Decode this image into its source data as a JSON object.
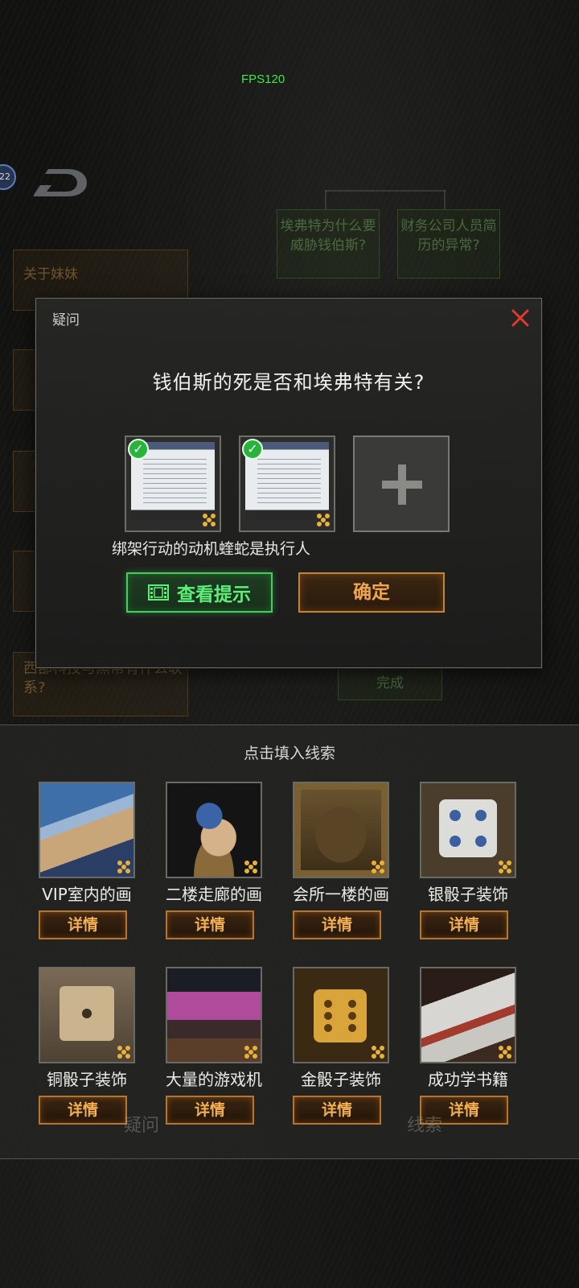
{
  "hud": {
    "fps": "FPS120",
    "badge": "22"
  },
  "background_nodes": {
    "node1": "埃弗特为什么要威胁钱伯斯?",
    "node2": "财务公司人员简历的异常?",
    "node3": "关于妹妹",
    "node4": "西部科技与黑帮有什么联系?",
    "node5": "完成",
    "tab_left": "疑问",
    "tab_right": "线索"
  },
  "dialog": {
    "title": "疑问",
    "question": "钱伯斯的死是否和埃弗特有关?",
    "slot_labels": "绑架行动的动机蝰蛇是执行人",
    "hint_button": "查看提示",
    "confirm_button": "确定"
  },
  "clue_panel": {
    "title": "点击填入线索",
    "detail_label": "详情",
    "items": [
      {
        "label": "VIP室内的画"
      },
      {
        "label": "二楼走廊的画"
      },
      {
        "label": "会所一楼的画"
      },
      {
        "label": "银骰子装饰"
      },
      {
        "label": "铜骰子装饰"
      },
      {
        "label": "大量的游戏机"
      },
      {
        "label": "金骰子装饰"
      },
      {
        "label": "成功学书籍"
      }
    ]
  },
  "colors": {
    "hint_green": "#3fd15a",
    "confirm_orange": "#c9822e",
    "close_red": "#e03a2a",
    "fps_green": "#3ce84a"
  }
}
